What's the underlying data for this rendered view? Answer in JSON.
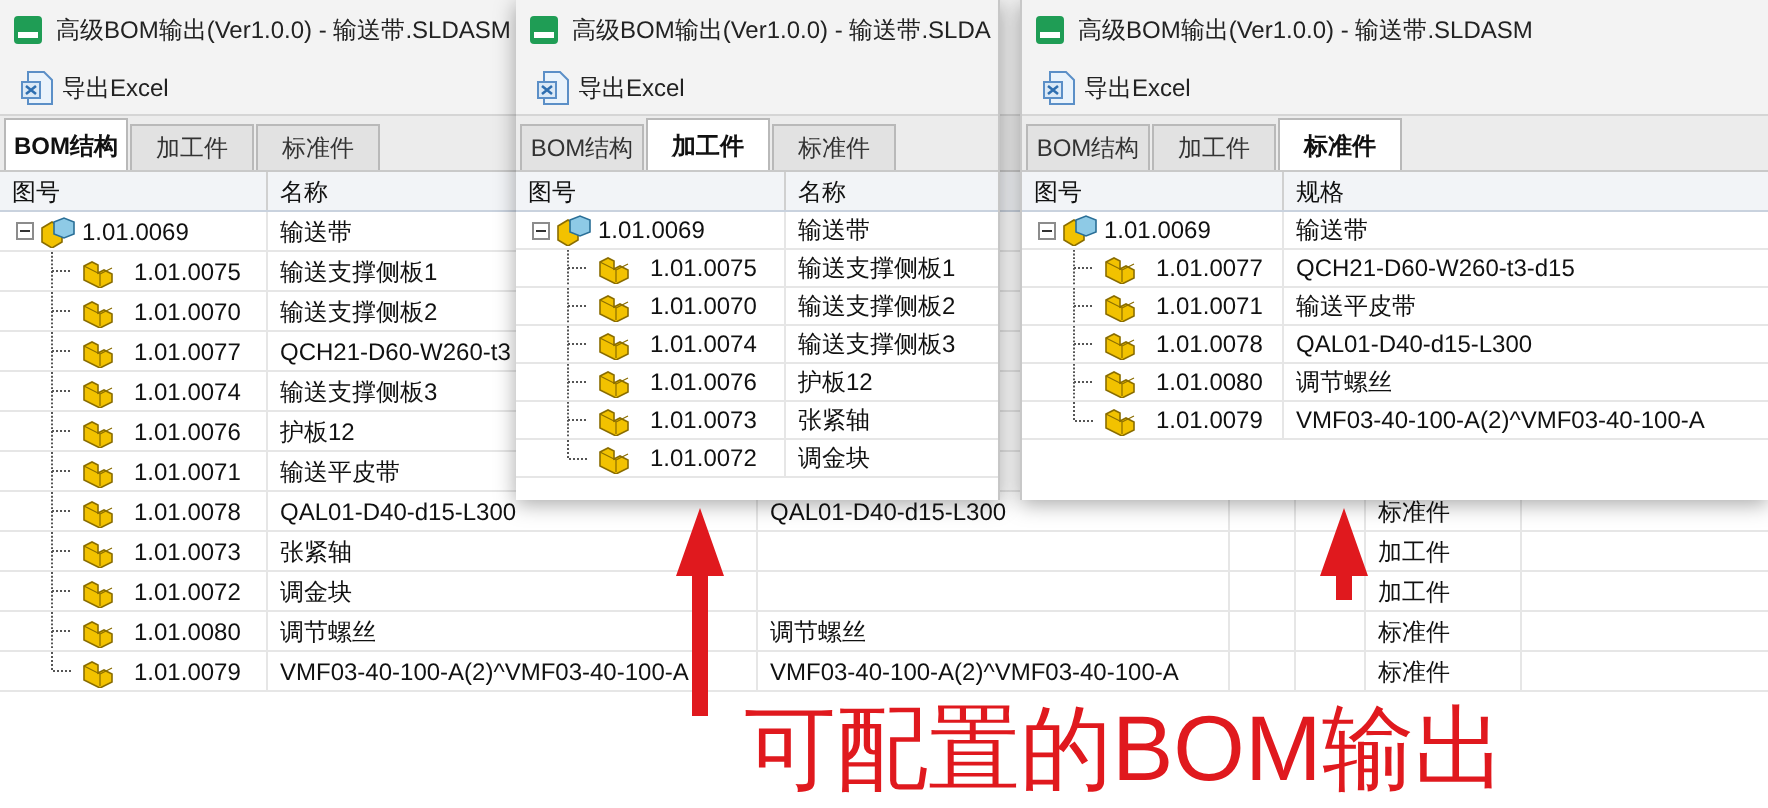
{
  "windows": [
    {
      "title": "高级BOM输出(Ver1.0.0) - 输送带.SLDASM",
      "toolbar_button": "导出Excel",
      "tabs": [
        {
          "label": "BOM结构",
          "selected": true
        },
        {
          "label": "加工件",
          "selected": false
        },
        {
          "label": "标准件",
          "selected": false
        }
      ],
      "columns": [
        "图号",
        "名称"
      ],
      "tree": {
        "number": "1.01.0069",
        "name": "输送带",
        "expanded": true,
        "children": [
          {
            "number": "1.01.0075",
            "name": "输送支撑侧板1"
          },
          {
            "number": "1.01.0070",
            "name": "输送支撑侧板2"
          },
          {
            "number": "1.01.0077",
            "name": "QCH21-D60-W260-t3"
          },
          {
            "number": "1.01.0074",
            "name": "输送支撑侧板3"
          },
          {
            "number": "1.01.0076",
            "name": "护板12"
          },
          {
            "number": "1.01.0071",
            "name": "输送平皮带"
          },
          {
            "number": "1.01.0078",
            "name": "QAL01-D40-d15-L300",
            "column_3": "QAL01-D40-d15-L300",
            "column_6": "标准件"
          },
          {
            "number": "1.01.0073",
            "name": "张紧轴",
            "column_6": "加工件"
          },
          {
            "number": "1.01.0072",
            "name": "调金块",
            "column_6": "加工件"
          },
          {
            "number": "1.01.0080",
            "name": "调节螺丝",
            "column_3": "调节螺丝",
            "column_6": "标准件"
          },
          {
            "number": "1.01.0079",
            "name": "VMF03-40-100-A(2)^VMF03-40-100-A",
            "column_3": "VMF03-40-100-A(2)^VMF03-40-100-A",
            "column_6": "标准件"
          }
        ]
      }
    },
    {
      "title": "高级BOM输出(Ver1.0.0) - 输送带.SLDA",
      "toolbar_button": "导出Excel",
      "tabs": [
        {
          "label": "BOM结构",
          "selected": false
        },
        {
          "label": "加工件",
          "selected": true
        },
        {
          "label": "标准件",
          "selected": false
        }
      ],
      "columns": [
        "图号",
        "名称"
      ],
      "tree": {
        "number": "1.01.0069",
        "name": "输送带",
        "expanded": true,
        "children": [
          {
            "number": "1.01.0075",
            "name": "输送支撑侧板1"
          },
          {
            "number": "1.01.0070",
            "name": "输送支撑侧板2"
          },
          {
            "number": "1.01.0074",
            "name": "输送支撑侧板3"
          },
          {
            "number": "1.01.0076",
            "name": "护板12"
          },
          {
            "number": "1.01.0073",
            "name": "张紧轴"
          },
          {
            "number": "1.01.0072",
            "name": "调金块"
          }
        ]
      }
    },
    {
      "title": "高级BOM输出(Ver1.0.0) - 输送带.SLDASM",
      "toolbar_button": "导出Excel",
      "tabs": [
        {
          "label": "BOM结构",
          "selected": false
        },
        {
          "label": "加工件",
          "selected": false
        },
        {
          "label": "标准件",
          "selected": true
        }
      ],
      "columns": [
        "图号",
        "规格"
      ],
      "tree": {
        "number": "1.01.0069",
        "name": "输送带",
        "expanded": true,
        "children": [
          {
            "number": "1.01.0077",
            "name": "QCH21-D60-W260-t3-d15"
          },
          {
            "number": "1.01.0071",
            "name": "输送平皮带"
          },
          {
            "number": "1.01.0078",
            "name": "QAL01-D40-d15-L300"
          },
          {
            "number": "1.01.0080",
            "name": "调节螺丝"
          },
          {
            "number": "1.01.0079",
            "name": "VMF03-40-100-A(2)^VMF03-40-100-A"
          }
        ]
      }
    }
  ],
  "caption": "可配置的BOM输出"
}
